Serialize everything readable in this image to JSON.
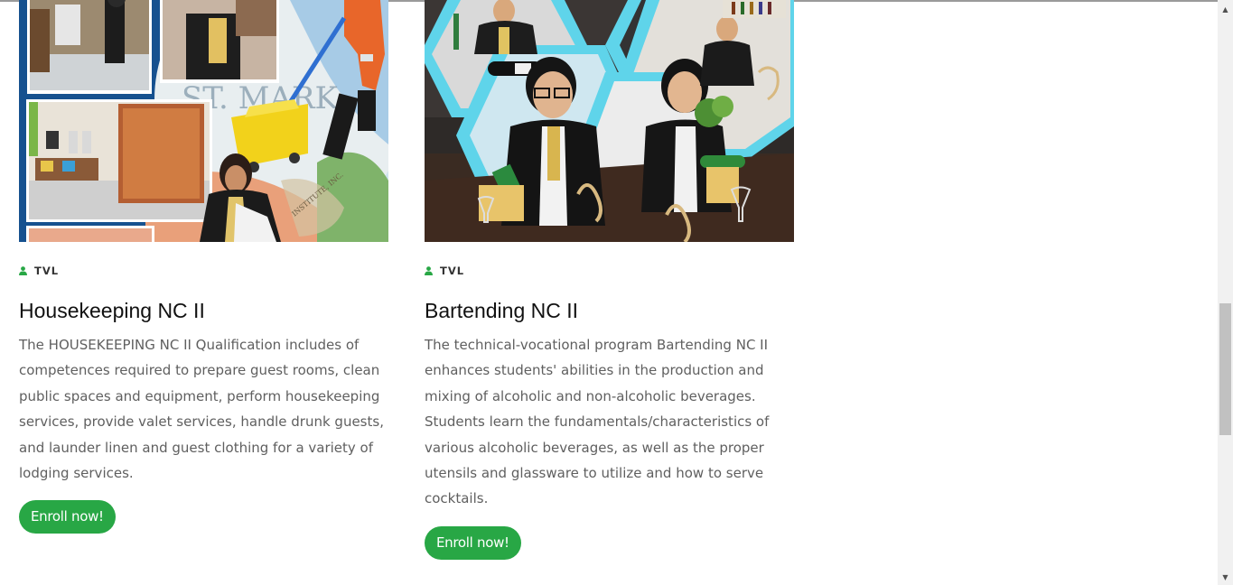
{
  "cards": [
    {
      "category": "TVL",
      "title": "Housekeeping NC II",
      "description": "The HOUSEKEEPING NC II Qualification includes of competences required to prepare guest rooms, clean public spaces and equipment, perform housekeeping services, provide valet services, handle drunk guests, and launder linen and guest clothing for a variety of lodging services.",
      "button": "Enroll now!",
      "image_text": "ST. MARK",
      "image_seal_text": "INSTITUTE, INC."
    },
    {
      "category": "TVL",
      "title": "Bartending NC II",
      "description": "The technical-vocational program Bartending NC II enhances students' abilities in the production and mixing of alcoholic and non-alcoholic beverages. Students learn the fundamentals/characteristics of various alcoholic beverages, as well as the proper utensils and glassware to utilize and how to serve cocktails.",
      "button": "Enroll now!"
    }
  ],
  "icons": {
    "category": "user-icon"
  },
  "colors": {
    "accent": "#28a745",
    "cyan_frame": "#5fd4ea",
    "navy": "#0f3c78"
  },
  "scrollbar": {
    "up": "▲",
    "down": "▼",
    "position_fraction": 0.52
  }
}
